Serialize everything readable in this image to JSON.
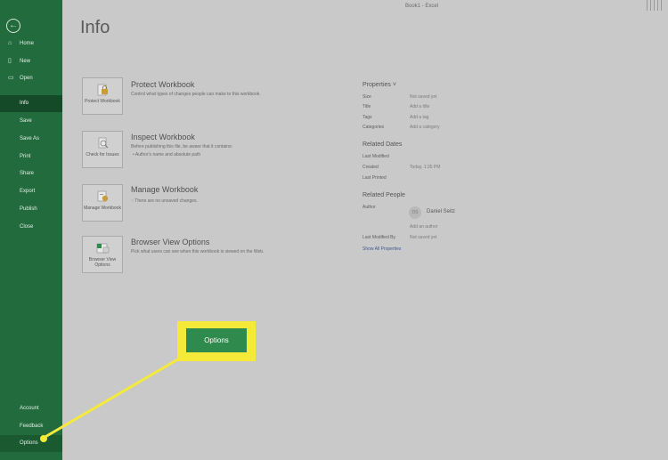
{
  "window": {
    "title": "Book1 - Excel"
  },
  "sidebar": {
    "items": [
      {
        "label": "Home",
        "icon": "home-icon"
      },
      {
        "label": "New",
        "icon": "new-file-icon"
      },
      {
        "label": "Open",
        "icon": "open-folder-icon"
      },
      {
        "label": "Info"
      },
      {
        "label": "Save"
      },
      {
        "label": "Save As"
      },
      {
        "label": "Print"
      },
      {
        "label": "Share"
      },
      {
        "label": "Export"
      },
      {
        "label": "Publish"
      },
      {
        "label": "Close"
      }
    ],
    "bottom": [
      {
        "label": "Account"
      },
      {
        "label": "Feedback"
      },
      {
        "label": "Options"
      }
    ]
  },
  "page": {
    "title": "Info"
  },
  "sections": [
    {
      "button": "Protect Workbook",
      "title": "Protect Workbook",
      "desc": "Control what types of changes people can make to this workbook."
    },
    {
      "button": "Check for Issues",
      "title": "Inspect Workbook",
      "desc": "Before publishing this file, be aware that it contains:",
      "bullet": "Author's name and absolute path"
    },
    {
      "button": "Manage Workbook",
      "title": "Manage Workbook",
      "desc": "There are no unsaved changes."
    },
    {
      "button": "Browser View Options",
      "title": "Browser View Options",
      "desc": "Pick what users can see when this workbook is viewed on the Web."
    }
  ],
  "properties": {
    "heading": "Properties",
    "rows": [
      {
        "label": "Size",
        "value": "Not saved yet"
      },
      {
        "label": "Title",
        "value": "Add a title"
      },
      {
        "label": "Tags",
        "value": "Add a tag"
      },
      {
        "label": "Categories",
        "value": "Add a category"
      }
    ],
    "dates_heading": "Related Dates",
    "dates": [
      {
        "label": "Last Modified",
        "value": ""
      },
      {
        "label": "Created",
        "value": "Today, 1:35 PM"
      },
      {
        "label": "Last Printed",
        "value": ""
      }
    ],
    "people_heading": "Related People",
    "author_label": "Author",
    "author_initials": "DS",
    "author_name": "Daniel Seitz",
    "add_author": "Add an author",
    "last_modified_by_label": "Last Modified By",
    "last_modified_by_value": "Not saved yet",
    "show_all": "Show All Properties"
  },
  "callout": {
    "label": "Options",
    "color": "#f5ea3a",
    "button_color": "#2e8a4d"
  }
}
